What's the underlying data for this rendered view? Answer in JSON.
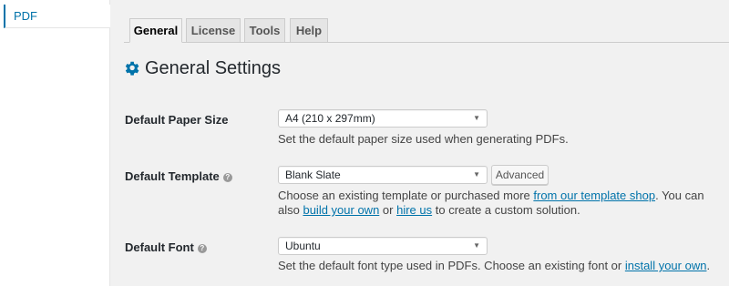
{
  "sidebar": {
    "items": [
      {
        "label": "PDF"
      }
    ]
  },
  "tabs": [
    {
      "label": "General"
    },
    {
      "label": "License"
    },
    {
      "label": "Tools"
    },
    {
      "label": "Help"
    }
  ],
  "page": {
    "title": "General Settings",
    "gear_icon": "gear-icon"
  },
  "paper_size": {
    "label": "Default Paper Size",
    "value": "A4 (210 x 297mm)",
    "desc": "Set the default paper size used when generating PDFs."
  },
  "template": {
    "label": "Default Template",
    "help_icon": "help-icon",
    "value": "Blank Slate",
    "advanced_label": "Advanced",
    "desc1": "Choose an existing template or purchased more ",
    "link_shop": "from our template shop",
    "desc2": ". You can also ",
    "link_build": "build your own",
    "desc3": " or ",
    "link_hire": "hire us",
    "desc4": " to create a custom solution."
  },
  "font": {
    "label": "Default Font",
    "help_icon": "help-icon",
    "value": "Ubuntu",
    "desc1": "Set the default font type used in PDFs. Choose an existing font or ",
    "link_install": "install your own",
    "desc2": "."
  },
  "colors": {
    "accent": "#0073aa",
    "background": "#f1f1f1"
  }
}
